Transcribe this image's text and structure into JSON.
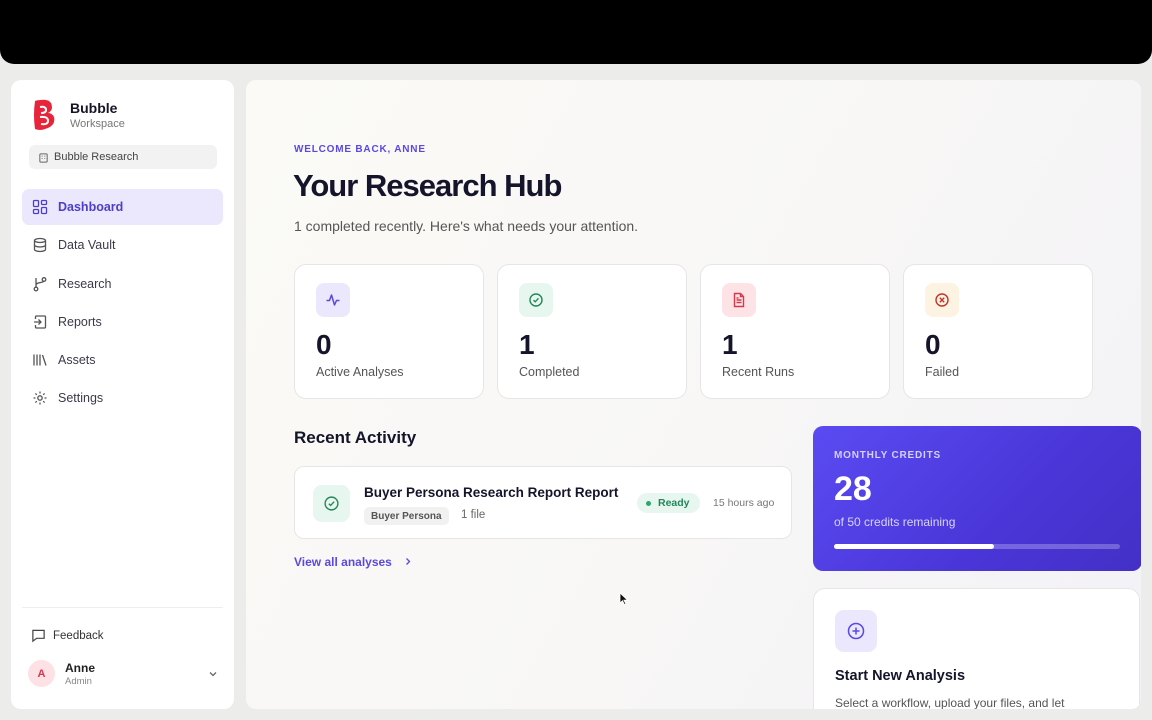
{
  "sidebar": {
    "brand_name": "Bubble",
    "brand_sub": "Workspace",
    "workspace": "Bubble Research",
    "items": [
      {
        "label": "Dashboard",
        "icon": "dashboard-icon",
        "active": true
      },
      {
        "label": "Data Vault",
        "icon": "database-icon"
      },
      {
        "label": "Research",
        "icon": "branch-icon"
      },
      {
        "label": "Reports",
        "icon": "reports-icon"
      },
      {
        "label": "Assets",
        "icon": "library-icon"
      },
      {
        "label": "Settings",
        "icon": "gear-icon"
      }
    ],
    "feedback": "Feedback",
    "user": {
      "initial": "A",
      "name": "Anne",
      "role": "Admin"
    }
  },
  "main": {
    "welcome": "WELCOME BACK, ANNE",
    "title": "Your Research Hub",
    "subtitle": "1 completed recently. Here's what needs your attention.",
    "stats": [
      {
        "value": "0",
        "label": "Active Analyses",
        "icon": "activity-icon",
        "bg": "#ebe7fd",
        "color": "#5a49e0"
      },
      {
        "value": "1",
        "label": "Completed",
        "icon": "check-circle-icon",
        "bg": "#e7f6ee",
        "color": "#23875a"
      },
      {
        "value": "1",
        "label": "Recent Runs",
        "icon": "document-icon",
        "bg": "#fde3e6",
        "color": "#d23a4f"
      },
      {
        "value": "0",
        "label": "Failed",
        "icon": "x-circle-icon",
        "bg": "#fdf3e2",
        "color": "#c0342c"
      }
    ],
    "recent_activity_title": "Recent Activity",
    "activity": {
      "title": "Buyer Persona Research Report Report",
      "tag": "Buyer Persona",
      "files": "1 file",
      "status": "Ready",
      "time": "15 hours ago"
    },
    "view_all": "View all analyses",
    "credits": {
      "label": "MONTHLY CREDITS",
      "value": "28",
      "sub": "of 50 credits remaining",
      "fraction_remaining": 0.56
    },
    "start": {
      "title": "Start New Analysis",
      "desc": "Select a workflow, upload your files, and let"
    }
  }
}
